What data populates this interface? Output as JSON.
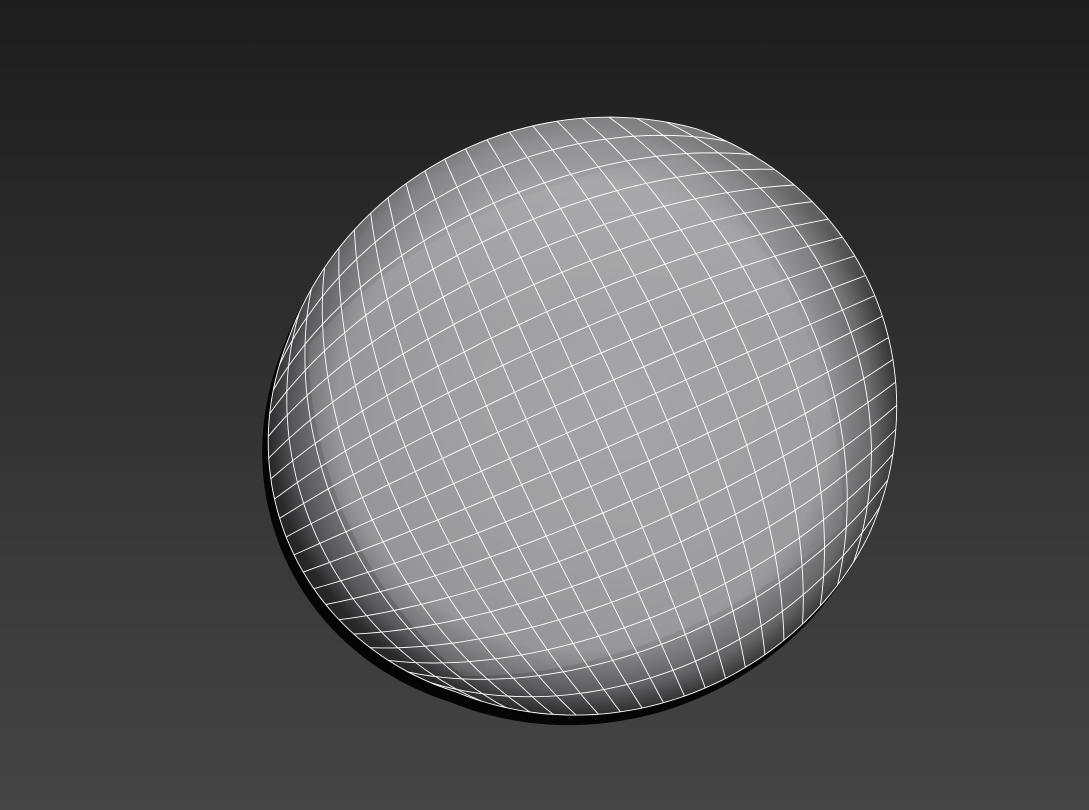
{
  "viewport": {
    "background_top": "#1d1d1d",
    "background_bottom": "#454545"
  },
  "object": {
    "kind": "quad-wireframe-rounded-mesh",
    "shading": "smooth-grey",
    "surface_color": "#9a9a9c",
    "edge_color": "#ffffff",
    "grid_rows": 20,
    "grid_cols": 20
  }
}
